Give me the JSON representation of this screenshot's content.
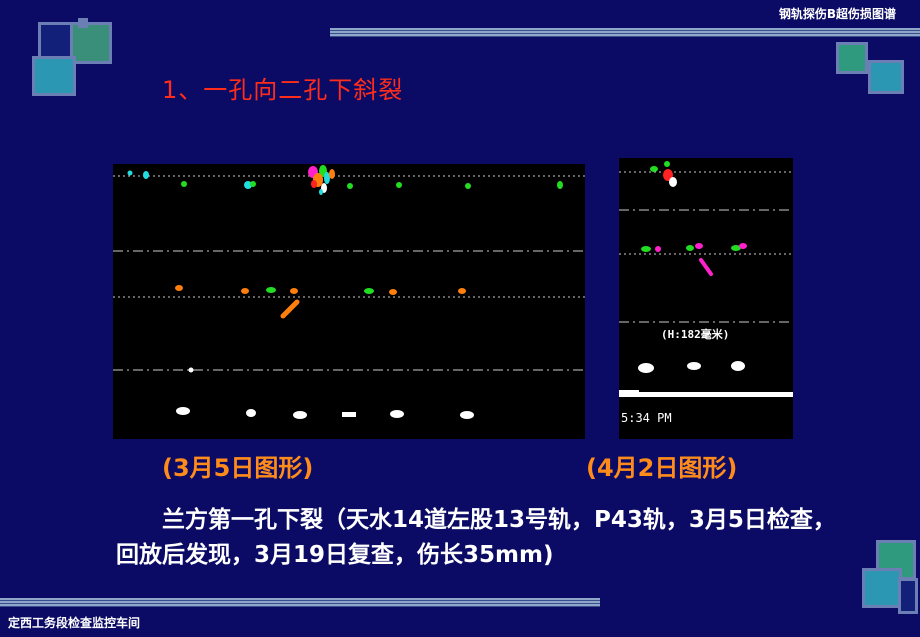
{
  "header": {
    "title": "钢轨探伤B超伤损图谱"
  },
  "slide": {
    "title": "1、一孔向二孔下斜裂"
  },
  "scan_left": {
    "caption": "(3月5日图形)"
  },
  "scan_right": {
    "caption": "(4月2日图形)",
    "depth_label": "(H:182毫米)",
    "time_label": "5:34 PM"
  },
  "description": "兰方第一孔下裂（天水14道左股13号轨，P43轨，3月5日检查，回放后发现，3月19日复查，伤长35mm)",
  "footer": {
    "text": "定西工务段检查监控车间"
  },
  "colors": {
    "background": "#0b0b66",
    "title_red": "#ff2d1a",
    "caption_orange": "#ff8c1a",
    "scan_green": "#22dd22",
    "scan_orange": "#ff7f0e",
    "scan_magenta": "#ff22cc",
    "scan_cyan": "#22dddd"
  }
}
